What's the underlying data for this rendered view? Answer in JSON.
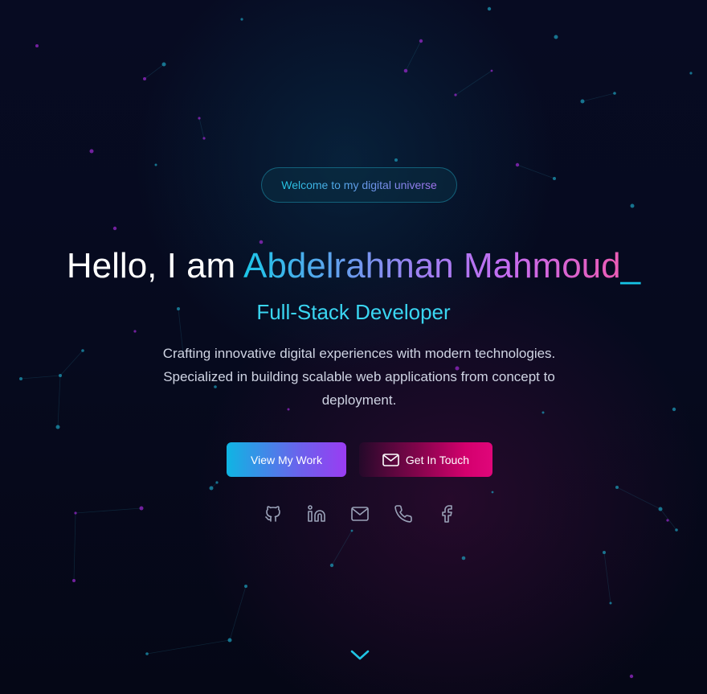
{
  "hero": {
    "badge": "Welcome to my digital universe",
    "greeting": "Hello, I am ",
    "name": "Abdelrahman Mahmoud",
    "cursor": "_",
    "role": "Full-Stack Developer",
    "description": "Crafting innovative digital experiences with modern technologies. Specialized in building scalable web applications from concept to deployment."
  },
  "buttons": {
    "work_label": "View My Work",
    "touch_label": "Get In Touch",
    "touch_icon": "mail-icon"
  },
  "socials": [
    {
      "icon": "github-icon"
    },
    {
      "icon": "linkedin-icon"
    },
    {
      "icon": "mail-icon"
    },
    {
      "icon": "phone-icon"
    },
    {
      "icon": "facebook-icon"
    }
  ],
  "scroll": {
    "icon": "chevron-down-icon"
  },
  "colors": {
    "background": "#050818",
    "accent_cyan": "#1cc6e8",
    "accent_purple": "#9a3cf2",
    "accent_pink": "#e0067a",
    "role_text": "#3ad6f2",
    "description_text": "#cfd4e3"
  }
}
